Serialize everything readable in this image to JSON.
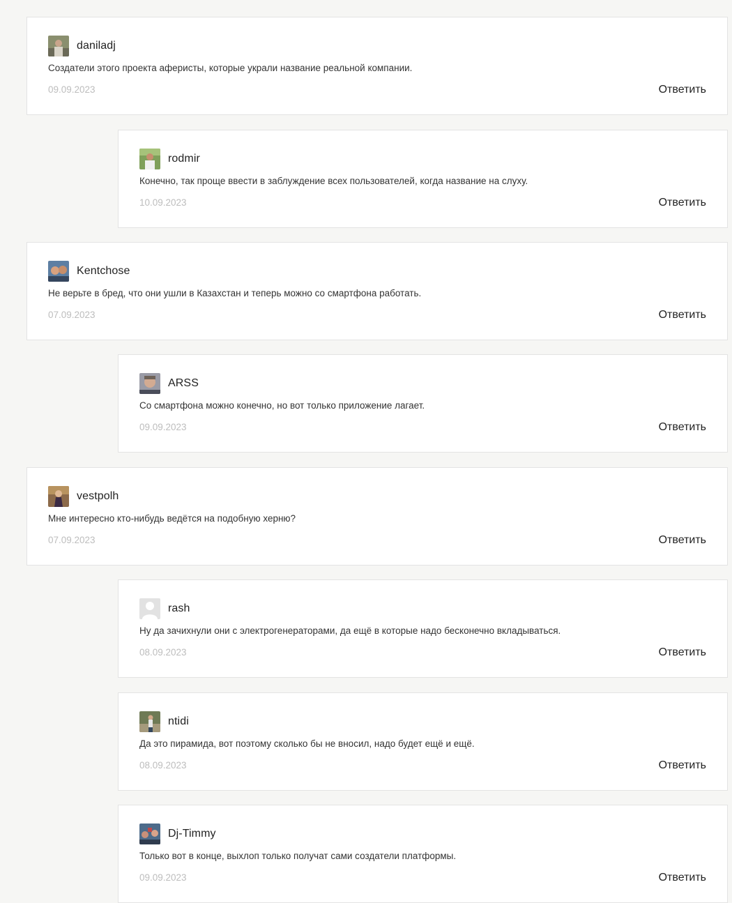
{
  "reply_label": "Ответить",
  "comments": [
    {
      "author": "daniladj",
      "text": "Создатели этого проекта аферисты, которые украли название реальной компании.",
      "date": "09.09.2023",
      "level": "root",
      "avatar": "photo"
    },
    {
      "author": "rodmir",
      "text": "Конечно, так проще ввести в заблуждение всех пользователей, когда название на слуху.",
      "date": "10.09.2023",
      "level": "reply",
      "avatar": "photo"
    },
    {
      "author": "Kentchose",
      "text": "Не верьте в бред, что они ушли в Казахстан и теперь можно со смартфона работать.",
      "date": "07.09.2023",
      "level": "root",
      "avatar": "photo"
    },
    {
      "author": "ARSS",
      "text": "Со смартфона можно конечно, но вот только приложение лагает.",
      "date": "09.09.2023",
      "level": "reply",
      "avatar": "photo"
    },
    {
      "author": "vestpolh",
      "text": "Мне интересно кто-нибудь ведётся на подобную херню?",
      "date": "07.09.2023",
      "level": "root",
      "avatar": "photo"
    },
    {
      "author": "rash",
      "text": "Ну да зачихнули они с электрогенераторами, да ещё в которые надо бесконечно вкладываться.",
      "date": "08.09.2023",
      "level": "reply",
      "avatar": "default"
    },
    {
      "author": "ntidi",
      "text": "Да это пирамида, вот поэтому сколько бы не вносил, надо будет ещё и ещё.",
      "date": "08.09.2023",
      "level": "reply",
      "avatar": "photo"
    },
    {
      "author": "Dj-Timmy",
      "text": "Только вот в конце, выхлоп только получат сами создатели платформы.",
      "date": "09.09.2023",
      "level": "reply",
      "avatar": "photo"
    }
  ]
}
